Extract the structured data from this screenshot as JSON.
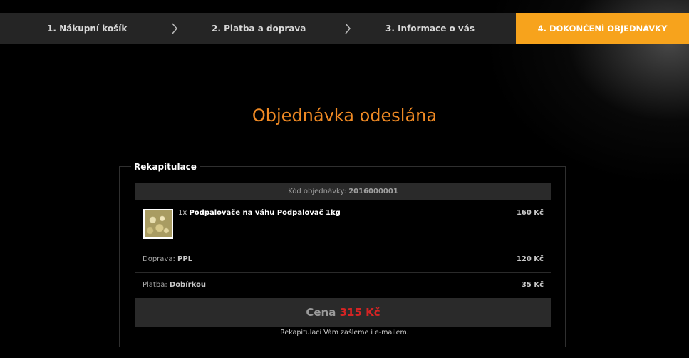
{
  "steps": [
    {
      "label": "1. Nákupní košík"
    },
    {
      "label": "2. Platba a doprava"
    },
    {
      "label": "3. Informace o vás"
    },
    {
      "label": "4. DOKONČENÍ OBJEDNÁVKY"
    }
  ],
  "colors": {
    "accent": "#f7a31c",
    "title": "#f08a24",
    "price_total": "#d42424"
  },
  "page_title": "Objednávka odeslána",
  "recap": {
    "title": "Rekapitulace",
    "order_code_label": "Kód objednávky:",
    "order_code": "2016000001",
    "item": {
      "qty": "1x",
      "name": "Podpalovače na váhu Podpalovač 1kg",
      "price": "160 Kč",
      "image_alt": "product-thumbnail"
    },
    "shipping": {
      "label": "Doprava:",
      "value": "PPL",
      "price": "120 Kč"
    },
    "payment": {
      "label": "Platba:",
      "value": "Dobírkou",
      "price": "35 Kč"
    },
    "total": {
      "label": "Cena",
      "value": "315 Kč"
    },
    "note": "Rekapitulaci Vám zašleme i e-mailem."
  }
}
